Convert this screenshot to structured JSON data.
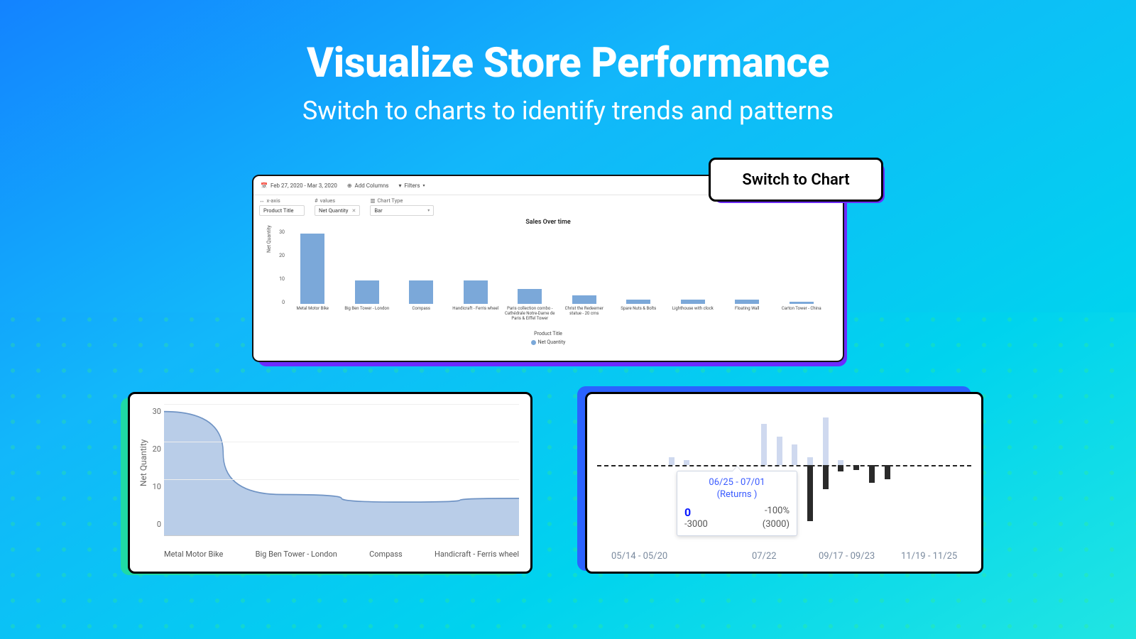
{
  "hero": {
    "title": "Visualize Store Performance",
    "subtitle": "Switch to charts to identify trends and patterns"
  },
  "switch_pill": "Switch to Chart",
  "main_card": {
    "date_range": "Feb 27, 2020 - Mar 3, 2020",
    "add_columns": "Add Columns",
    "filters": "Filters",
    "config": {
      "x_axis_label": "x-axis",
      "x_axis_value": "Product Title",
      "values_label": "values",
      "values_value": "Net Quantity",
      "chart_type_label": "Chart Type",
      "chart_type_value": "Bar"
    },
    "chart_title": "Sales Over time",
    "y_axis_label": "Net Quantity",
    "x_axis_title": "Product Title",
    "legend": "Net Quantity",
    "y_ticks": [
      "0",
      "10",
      "20",
      "30"
    ]
  },
  "area_card": {
    "y_axis_label": "Net Quantity",
    "y_ticks": [
      "0",
      "10",
      "20",
      "30"
    ],
    "x_labels": [
      "Metal Motor Bike",
      "Big Ben Tower - London",
      "Compass",
      "Handicraft - Ferris wheel"
    ]
  },
  "column_card": {
    "x_labels": [
      "05/14 - 05/20",
      "07/22",
      "09/17 - 09/23",
      "11/19 - 11/25"
    ],
    "tooltip": {
      "range": "06/25 - 07/01",
      "metric": "(Returns )",
      "value": "0",
      "pct": "-100%",
      "delta": "-3000",
      "prev": "(3000)"
    }
  },
  "chart_data": [
    {
      "type": "bar",
      "title": "Sales Over time",
      "xlabel": "Product Title",
      "ylabel": "Net Quantity",
      "ylim": [
        0,
        35
      ],
      "categories": [
        "Metal Motor Bike",
        "Big Ben Tower - London",
        "Compass",
        "Handicraft - Ferris wheel",
        "Paris collection combo - Cathédrale Notre-Dame de Paris & Eiffel Tower",
        "Christ the Redeemer statue - 20 cms",
        "Spare Nuts & Bolts",
        "Lighthouse with clock",
        "Floating Wall",
        "Carton Tower - China"
      ],
      "values": [
        33,
        11,
        11,
        11,
        7,
        4,
        2,
        2,
        2,
        1
      ]
    },
    {
      "type": "area",
      "ylabel": "Net Quantity",
      "ylim": [
        0,
        35
      ],
      "categories": [
        "Metal Motor Bike",
        "Big Ben Tower - London",
        "Compass",
        "Handicraft - Ferris wheel"
      ],
      "values": [
        33,
        11,
        9,
        10
      ]
    },
    {
      "type": "bar",
      "title": "Weekly deltas",
      "series": [
        {
          "name": "light",
          "values": [
            0,
            0,
            0,
            0,
            10,
            6,
            0,
            0,
            0,
            0,
            52,
            36,
            26,
            10,
            60,
            6,
            0,
            0,
            0,
            0,
            0,
            0,
            0,
            0
          ]
        },
        {
          "name": "dark_negatives",
          "values": [
            0,
            0,
            0,
            0,
            0,
            0,
            0,
            0,
            0,
            0,
            0,
            0,
            0,
            -70,
            -30,
            -8,
            -6,
            -22,
            -18,
            0,
            0,
            0,
            0,
            0
          ]
        }
      ],
      "x_index": [
        0,
        1,
        2,
        3,
        4,
        5,
        6,
        7,
        8,
        9,
        10,
        11,
        12,
        13,
        14,
        15,
        16,
        17,
        18,
        19,
        20,
        21,
        22,
        23
      ],
      "x_ticks": {
        "0": "05/14 - 05/20",
        "9": "07/22",
        "14": "09/17 - 09/23",
        "21": "11/19 - 11/25"
      },
      "ylim": [
        -80,
        80
      ]
    }
  ]
}
